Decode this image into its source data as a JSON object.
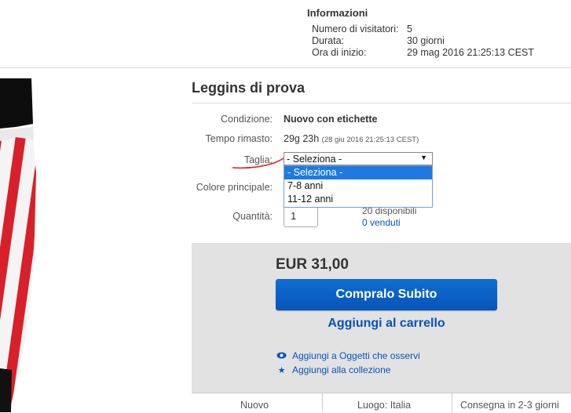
{
  "info": {
    "title": "Informazioni",
    "rows": [
      {
        "label": "Numero di visitatori:",
        "value": "5"
      },
      {
        "label": "Durata:",
        "value": "30 giorni"
      },
      {
        "label": "Ora di inizio:",
        "value": "29 mag 2016 21:25:13 CEST"
      }
    ]
  },
  "item": {
    "title": "Leggins di prova",
    "condition_label": "Condizione:",
    "condition_value": "Nuovo con etichette",
    "time_label": "Tempo rimasto:",
    "time_value": "29g 23h",
    "time_detail": "(28 giu 2016  21:25:13 CEST)",
    "size_label": "Taglia:",
    "size_selected": "- Seleziona -",
    "size_options": [
      "- Seleziona -",
      "7-8 anni",
      "11-12 anni"
    ],
    "color_label": "Colore principale:",
    "qty_label": "Quantità:",
    "qty_value": "1",
    "available": "20 disponibili",
    "sold": "0 venduti"
  },
  "buy": {
    "price": "EUR 31,00",
    "buy_now": "Compralo Subito",
    "add_cart": "Aggiungi al carrello",
    "watch": "Aggiungi a Oggetti che osservi",
    "collection": "Aggiungi alla collezione"
  },
  "bottom": {
    "cell1": "Nuovo",
    "cell2": "Luogo: Italia",
    "cell3": "Consegna in 2-3 giorni"
  },
  "colors": {
    "accent": "#0654ba",
    "highlight": "#1e7ae0",
    "annotation": "#e0191b"
  }
}
